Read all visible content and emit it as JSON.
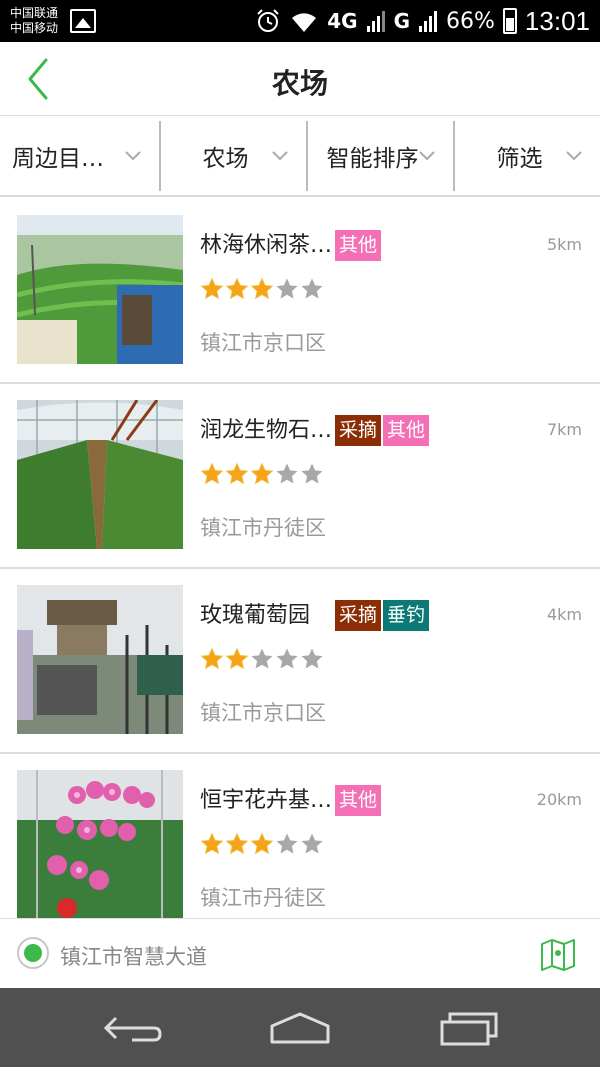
{
  "status_bar": {
    "carrier1": "中国联通",
    "carrier2": "中国移动",
    "network1": "4G",
    "network2": "G",
    "battery": "66%",
    "time": "13:01"
  },
  "header": {
    "title": "农场"
  },
  "filters": [
    {
      "label": "周边目…"
    },
    {
      "label": "农场"
    },
    {
      "label": "智能排序"
    },
    {
      "label": "筛选"
    }
  ],
  "farms": [
    {
      "name": "林海休闲茶…",
      "tags": [
        "其他"
      ],
      "distance": "5km",
      "rating": 3,
      "district": "镇江市京口区"
    },
    {
      "name": "润龙生物石…",
      "tags": [
        "采摘",
        "其他"
      ],
      "distance": "7km",
      "rating": 3,
      "district": "镇江市丹徒区"
    },
    {
      "name": "玫瑰葡萄园",
      "tags": [
        "采摘",
        "垂钓"
      ],
      "distance": "4km",
      "rating": 2,
      "district": "镇江市京口区"
    },
    {
      "name": "恒宇花卉基…",
      "tags": [
        "其他"
      ],
      "distance": "20km",
      "rating": 3,
      "district": "镇江市丹徒区"
    }
  ],
  "location_bar": {
    "address": "镇江市智慧大道"
  },
  "colors": {
    "accent": "#3cb94a",
    "tag_other": "#f46fb6",
    "tag_pick": "#8b2e05",
    "tag_fish": "#0b7a74"
  }
}
